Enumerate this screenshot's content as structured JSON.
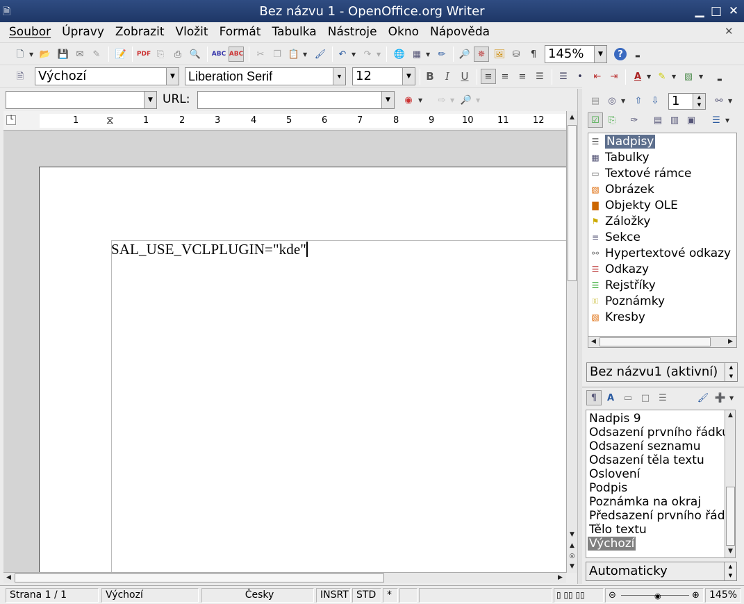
{
  "window": {
    "title": "Bez názvu 1 - OpenOffice.org Writer"
  },
  "menu": {
    "items": [
      {
        "label": "Soubor"
      },
      {
        "label": "Úpravy"
      },
      {
        "label": "Zobrazit"
      },
      {
        "label": "Vložit"
      },
      {
        "label": "Formát"
      },
      {
        "label": "Tabulka"
      },
      {
        "label": "Nástroje"
      },
      {
        "label": "Okno"
      },
      {
        "label": "Nápověda"
      }
    ]
  },
  "toolbar": {
    "zoom": "145%"
  },
  "format": {
    "para_style": "Výchozí",
    "font_name": "Liberation Serif",
    "font_size": "12"
  },
  "hyperlink": {
    "url_label": "URL:",
    "url_value": "",
    "name_value": ""
  },
  "ruler": {
    "numbers": [
      "1",
      "1",
      "2",
      "3",
      "4",
      "5",
      "6",
      "7",
      "8",
      "9",
      "10",
      "11",
      "12"
    ]
  },
  "document": {
    "text": "SAL_USE_VCLPLUGIN=\"kde\""
  },
  "navigator": {
    "page_number": "1",
    "items": [
      {
        "label": "Nadpisy",
        "icon": "headings-icon",
        "selected": true
      },
      {
        "label": "Tabulky",
        "icon": "tables-icon"
      },
      {
        "label": "Textové rámce",
        "icon": "text-frames-icon"
      },
      {
        "label": "Obrázek",
        "icon": "images-icon"
      },
      {
        "label": "Objekty OLE",
        "icon": "ole-objects-icon"
      },
      {
        "label": "Záložky",
        "icon": "bookmarks-icon"
      },
      {
        "label": "Sekce",
        "icon": "sections-icon"
      },
      {
        "label": "Hypertextové odkazy",
        "icon": "hyperlinks-icon"
      },
      {
        "label": "Odkazy",
        "icon": "references-icon"
      },
      {
        "label": "Rejstříky",
        "icon": "indexes-icon"
      },
      {
        "label": "Poznámky",
        "icon": "notes-icon"
      },
      {
        "label": "Kresby",
        "icon": "drawings-icon"
      }
    ],
    "document_select": "Bez názvu1 (aktivní)"
  },
  "styles": {
    "items": [
      {
        "label": "Nadpis 9"
      },
      {
        "label": "Odsazení prvního řádku"
      },
      {
        "label": "Odsazení seznamu"
      },
      {
        "label": "Odsazení těla textu"
      },
      {
        "label": "Oslovení"
      },
      {
        "label": "Podpis"
      },
      {
        "label": "Poznámka na okraj"
      },
      {
        "label": "Předsazení prvního řádku"
      },
      {
        "label": "Tělo textu"
      },
      {
        "label": "Výchozí",
        "selected": true
      }
    ],
    "filter": "Automaticky"
  },
  "status": {
    "page": "Strana 1 / 1",
    "style": "Výchozí",
    "language": "Česky",
    "insert_mode": "INSRT",
    "selection_mode": "STD",
    "modified": "*",
    "zoom": "145%"
  },
  "colors": {
    "titlebar": "#2a467c",
    "selection": "#5d6f8d",
    "style_selection": "#808080"
  }
}
